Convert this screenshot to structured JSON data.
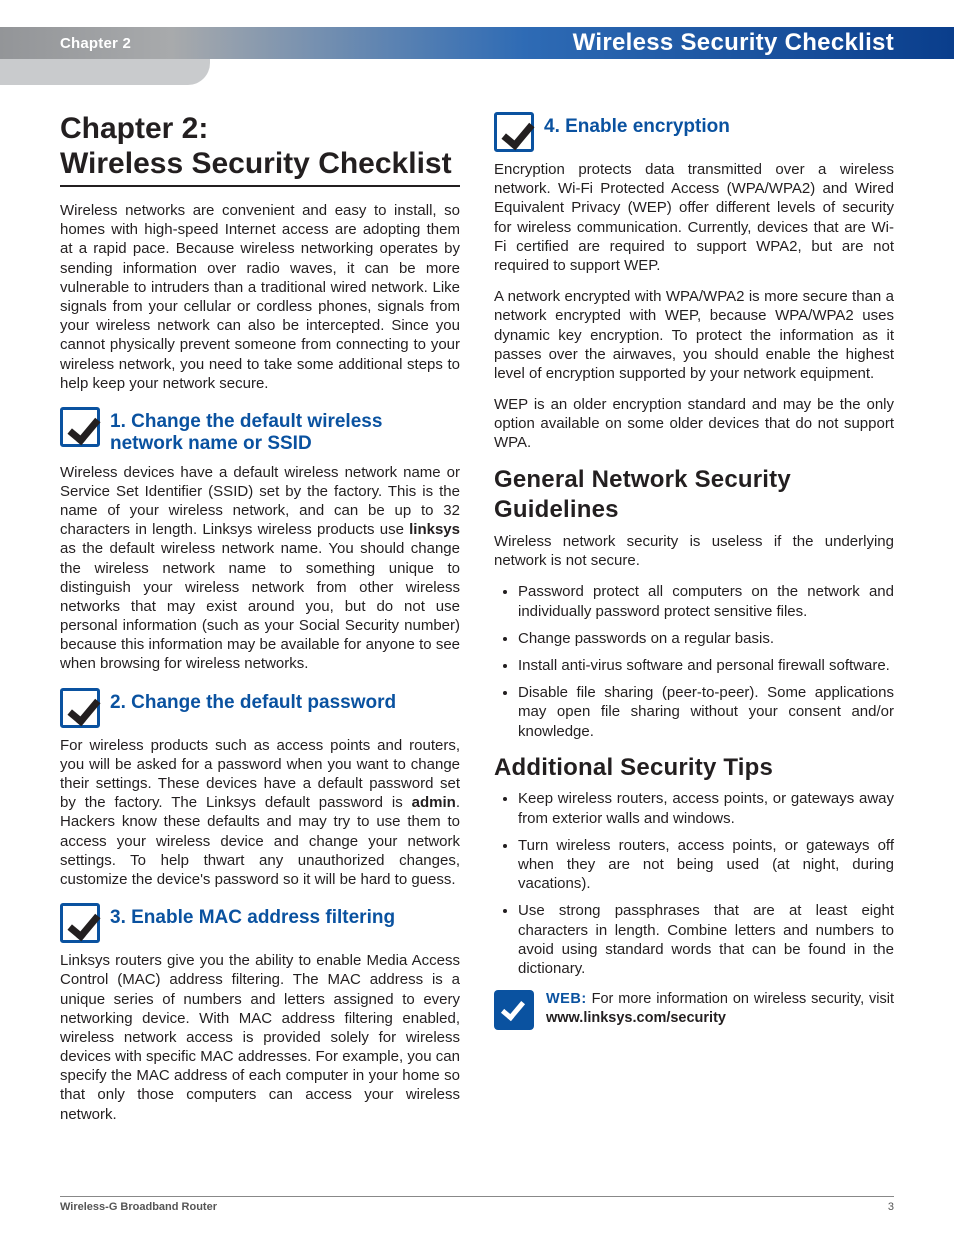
{
  "header": {
    "chapter_label": "Chapter 2",
    "title": "Wireless Security Checklist"
  },
  "chapter_heading": "Chapter 2:\nWireless Security Checklist",
  "intro": "Wireless networks are convenient and easy to install, so homes with high-speed Internet access are adopting them at a rapid pace. Because wireless networking operates by sending information over radio waves, it can be more vulnerable to intruders than a traditional wired network. Like signals from your cellular or cordless phones, signals from your wireless network can also be intercepted. Since you cannot physically prevent someone from connecting to your wireless network, you need to take some additional steps to help keep your network secure.",
  "sections": [
    {
      "title": "1.  Change the default wireless network name or SSID",
      "body_pre": "Wireless devices have a default wireless network name or Service Set Identifier (SSID) set by the factory. This is the name of your wireless network, and can be up to 32 characters in length. Linksys wireless products use ",
      "bold": "linksys",
      "body_post": " as the default wireless network name. You should change the wireless network name to something unique to distinguish your wireless network from other wireless networks that may exist around you, but do not use personal information (such as your Social Security number) because this information may be available for anyone to see when browsing for wireless networks."
    },
    {
      "title": "2.  Change the default password",
      "body_pre": "For wireless products such as access points and routers, you will be asked for a password when you want to change their settings. These devices have a default password set by the factory. The Linksys default password is ",
      "bold": "admin",
      "body_post": ". Hackers know these defaults and may try to use them to access your wireless device and change your network settings. To help thwart any unauthorized changes, customize the device's password so it will be hard to guess."
    },
    {
      "title": "3.  Enable MAC address filtering",
      "body": "Linksys routers give you the ability to enable Media Access Control (MAC) address filtering. The MAC address is a unique series of numbers and letters assigned to every networking device. With MAC address filtering enabled, wireless network access is provided solely for wireless devices with specific MAC addresses. For example, you can specify the MAC address of each computer in your home so that only those computers can access your wireless network."
    },
    {
      "title": "4.  Enable encryption",
      "paras": [
        "Encryption protects data transmitted over a wireless network. Wi-Fi Protected Access (WPA/WPA2) and Wired Equivalent Privacy (WEP) offer different levels of security for wireless communication. Currently, devices that are Wi-Fi certified are required to support WPA2, but are not required to support WEP.",
        "A network encrypted with WPA/WPA2 is more secure than a network encrypted with WEP, because WPA/WPA2 uses dynamic key encryption. To protect the information as it passes over the airwaves, you should enable the highest level of encryption supported by your network equipment.",
        "WEP is an older encryption standard and may be the only option available on some older devices that do not support WPA."
      ]
    }
  ],
  "general": {
    "heading": "General Network Security Guidelines",
    "intro": "Wireless network security is useless if the underlying network is not secure.",
    "items": [
      "Password protect all computers on the network and individually password protect sensitive files.",
      "Change passwords on a regular basis.",
      "Install anti-virus software and personal firewall software.",
      "Disable file sharing (peer-to-peer). Some applications may open file sharing without your consent and/or knowledge."
    ]
  },
  "tips": {
    "heading": "Additional Security Tips",
    "items": [
      "Keep wireless routers, access points, or gateways away from exterior walls and windows.",
      "Turn wireless routers, access points, or gateways off when they are not being used (at night, during vacations).",
      "Use strong passphrases that are at least eight characters in length. Combine letters and numbers to avoid using standard words that can be found in the dictionary."
    ]
  },
  "web": {
    "label": "WEB:",
    "text_pre": " For more information on wireless security, visit ",
    "link": "www.linksys.com/security"
  },
  "footer": {
    "product": "Wireless-G Broadband Router",
    "page": "3"
  }
}
